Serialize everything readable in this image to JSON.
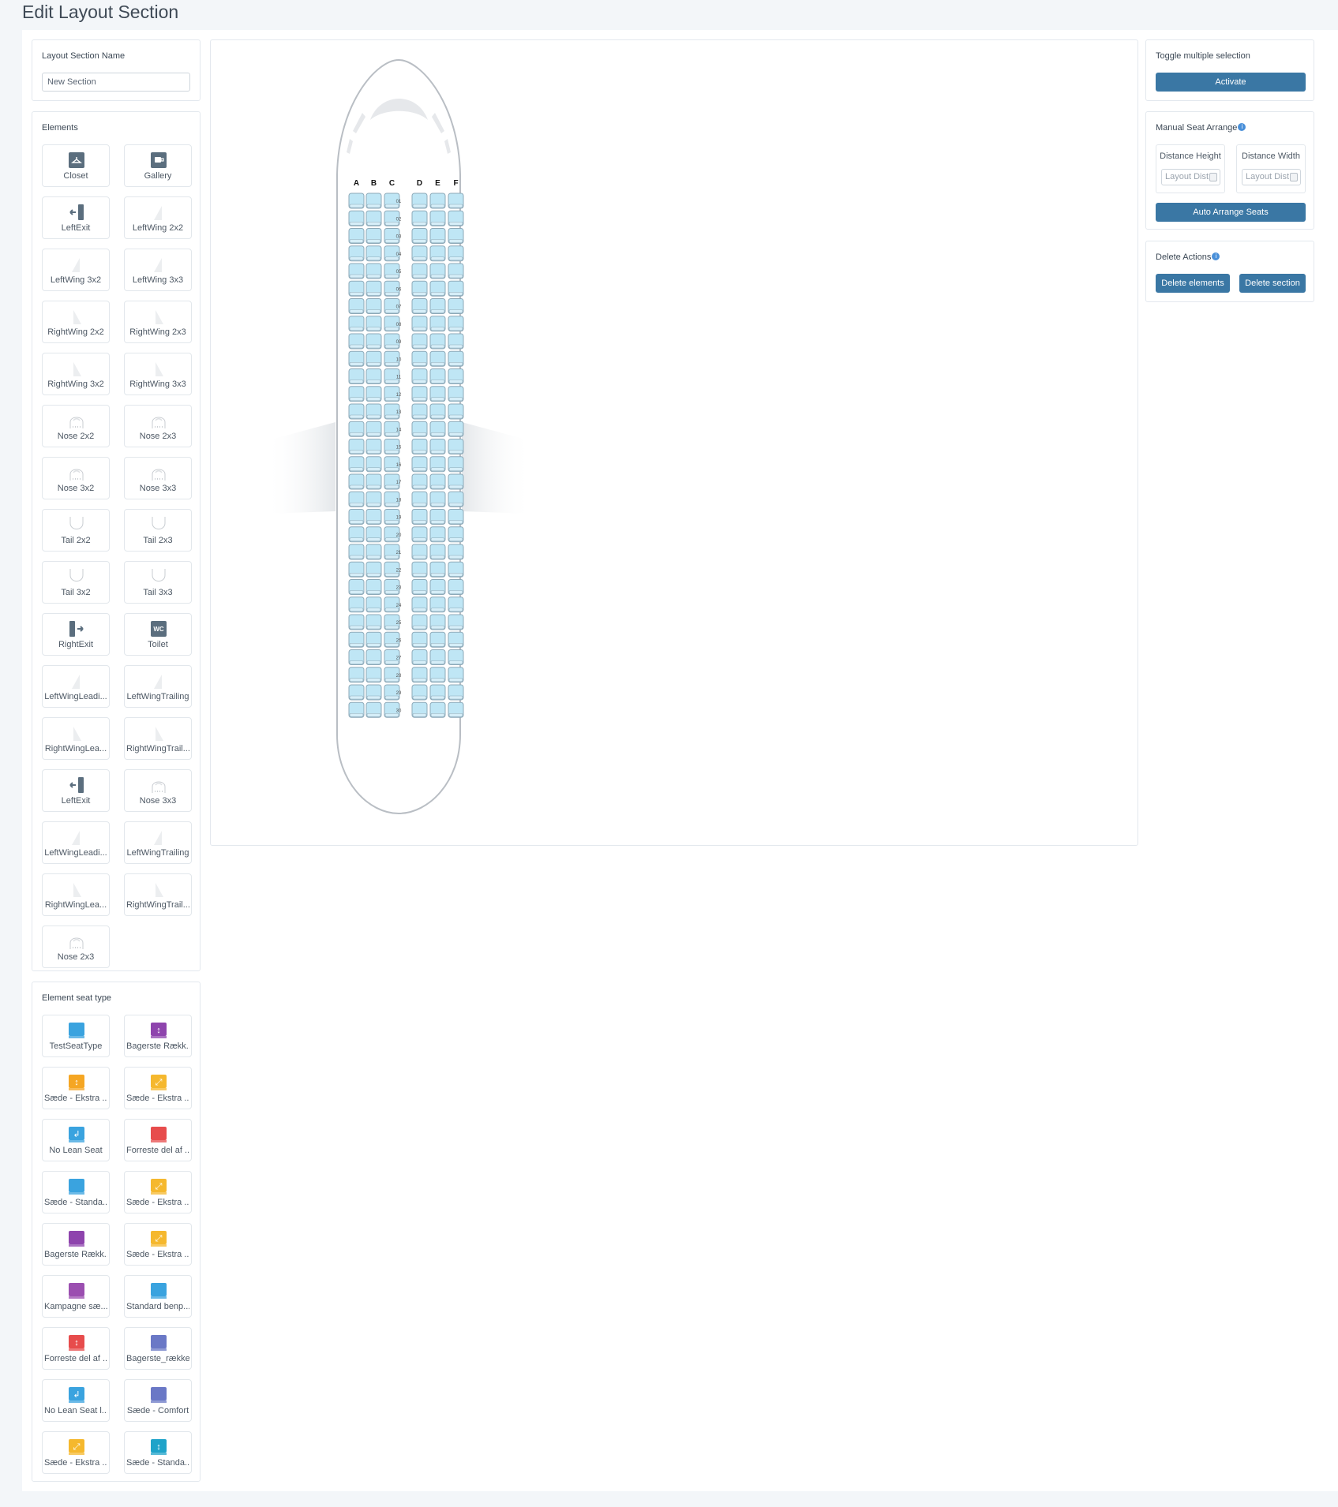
{
  "page": {
    "title": "Edit Layout Section"
  },
  "name_panel": {
    "label": "Layout Section Name",
    "value": "New Section"
  },
  "elements_panel": {
    "title": "Elements",
    "items": [
      {
        "label": "Closet",
        "icon": "closet-icon"
      },
      {
        "label": "Gallery",
        "icon": "gallery-icon"
      },
      {
        "label": "LeftExit",
        "icon": "left-exit-icon"
      },
      {
        "label": "LeftWing 2x2",
        "icon": "left-wing-icon"
      },
      {
        "label": "LeftWing 3x2",
        "icon": "left-wing-icon"
      },
      {
        "label": "LeftWing 3x3",
        "icon": "left-wing-icon"
      },
      {
        "label": "RightWing 2x2",
        "icon": "right-wing-icon"
      },
      {
        "label": "RightWing 2x3",
        "icon": "right-wing-icon"
      },
      {
        "label": "RightWing 3x2",
        "icon": "right-wing-icon"
      },
      {
        "label": "RightWing 3x3",
        "icon": "right-wing-icon"
      },
      {
        "label": "Nose 2x2",
        "icon": "nose-icon"
      },
      {
        "label": "Nose 2x3",
        "icon": "nose-icon"
      },
      {
        "label": "Nose 3x2",
        "icon": "nose-icon"
      },
      {
        "label": "Nose 3x3",
        "icon": "nose-icon"
      },
      {
        "label": "Tail 2x2",
        "icon": "tail-icon"
      },
      {
        "label": "Tail 2x3",
        "icon": "tail-icon"
      },
      {
        "label": "Tail 3x2",
        "icon": "tail-icon"
      },
      {
        "label": "Tail 3x3",
        "icon": "tail-icon"
      },
      {
        "label": "RightExit",
        "icon": "right-exit-icon"
      },
      {
        "label": "Toilet",
        "icon": "toilet-icon"
      },
      {
        "label": "LeftWingLeadi...",
        "icon": "left-wing-icon"
      },
      {
        "label": "LeftWingTrailing",
        "icon": "left-wing-icon"
      },
      {
        "label": "RightWingLea...",
        "icon": "right-wing-icon"
      },
      {
        "label": "RightWingTrail...",
        "icon": "right-wing-icon"
      },
      {
        "label": "LeftExit",
        "icon": "left-exit-icon"
      },
      {
        "label": "Nose 3x3",
        "icon": "nose-icon"
      },
      {
        "label": "LeftWingLeadi...",
        "icon": "left-wing-icon"
      },
      {
        "label": "LeftWingTrailing",
        "icon": "left-wing-icon"
      },
      {
        "label": "RightWingLea...",
        "icon": "right-wing-icon"
      },
      {
        "label": "RightWingTrail...",
        "icon": "right-wing-icon"
      },
      {
        "label": "Nose 2x3",
        "icon": "nose-icon"
      }
    ]
  },
  "seat_type_panel": {
    "title": "Element seat type",
    "items": [
      {
        "label": "TestSeatType",
        "color": "#3aa3df",
        "glyph": ""
      },
      {
        "label": "Bagerste Rækk...",
        "color": "#8e44ad",
        "glyph": "↕"
      },
      {
        "label": "Sæde - Ekstra ...",
        "color": "#f5a623",
        "glyph": "↕"
      },
      {
        "label": "Sæde - Ekstra ...",
        "color": "#f5b82e",
        "glyph": "⤢"
      },
      {
        "label": "No Lean Seat",
        "color": "#3aa3df",
        "glyph": "↲"
      },
      {
        "label": "Forreste del af ...",
        "color": "#e74c4c",
        "glyph": ""
      },
      {
        "label": "Sæde - Standa...",
        "color": "#3aa3df",
        "glyph": ""
      },
      {
        "label": "Sæde - Ekstra ...",
        "color": "#f5b82e",
        "glyph": "⤢"
      },
      {
        "label": "Bagerste Rækk...",
        "color": "#8e44ad",
        "glyph": ""
      },
      {
        "label": "Sæde - Ekstra ...",
        "color": "#f5b82e",
        "glyph": "⤢"
      },
      {
        "label": "Kampagne sæ...",
        "color": "#9b4fb0",
        "glyph": ""
      },
      {
        "label": "Standard benp...",
        "color": "#3aa3df",
        "glyph": ""
      },
      {
        "label": "Forreste del af ...",
        "color": "#e74c4c",
        "glyph": "↕"
      },
      {
        "label": "Bagerste_rækker",
        "color": "#6a78c6",
        "glyph": ""
      },
      {
        "label": "No Lean Seat l...",
        "color": "#3aa3df",
        "glyph": "↲"
      },
      {
        "label": "Sæde - Comfort",
        "color": "#6a78c6",
        "glyph": ""
      },
      {
        "label": "Sæde - Ekstra ...",
        "color": "#f5b82e",
        "glyph": "⤢"
      },
      {
        "label": "Sæde - Standa...",
        "color": "#1fa3c9",
        "glyph": "↕"
      }
    ]
  },
  "toggle_panel": {
    "title": "Toggle multiple selection",
    "button": "Activate"
  },
  "arrange_panel": {
    "title": "Manual Seat Arrange",
    "height_label": "Distance Height",
    "width_label": "Distance Width",
    "height_placeholder": "Layout Dist",
    "width_placeholder": "Layout Dist",
    "button": "Auto Arrange Seats"
  },
  "delete_panel": {
    "title": "Delete Actions",
    "delete_elements": "Delete elements",
    "delete_section": "Delete section"
  },
  "seat_map": {
    "column_letters": [
      "A",
      "B",
      "C",
      "D",
      "E",
      "F"
    ],
    "rows": [
      "01",
      "02",
      "03",
      "04",
      "05",
      "06",
      "07",
      "08",
      "09",
      "10",
      "11",
      "12",
      "13",
      "14",
      "15",
      "16",
      "17",
      "18",
      "19",
      "20",
      "21",
      "22",
      "23",
      "24",
      "25",
      "26",
      "27",
      "28",
      "29",
      "30"
    ],
    "seat_color": "#bfe6f5"
  },
  "colors": {
    "accent": "#3a77a4",
    "info": "#4a90d9"
  }
}
